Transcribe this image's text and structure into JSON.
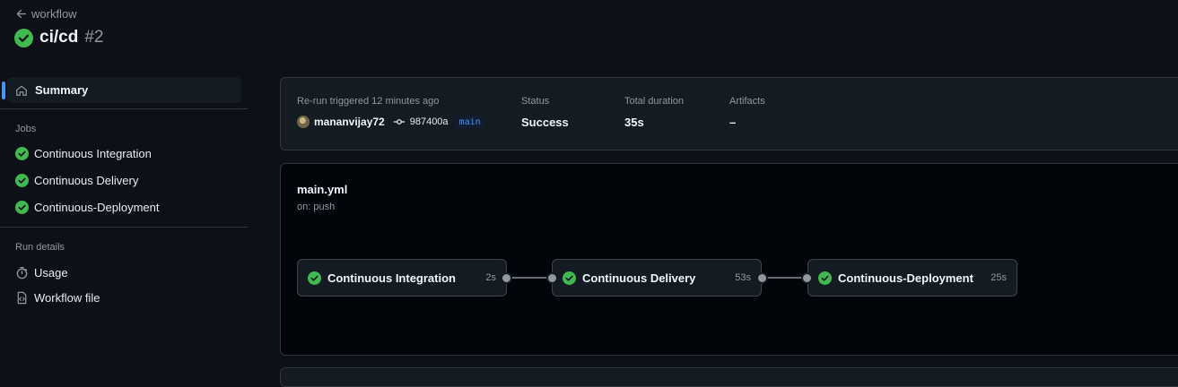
{
  "header": {
    "back_label": "workflow",
    "title": "ci/cd",
    "run_number": "#2"
  },
  "sidebar": {
    "summary_label": "Summary",
    "jobs_heading": "Jobs",
    "jobs": [
      {
        "label": "Continuous Integration"
      },
      {
        "label": "Continuous Delivery"
      },
      {
        "label": "Continuous-Deployment"
      }
    ],
    "run_details_heading": "Run details",
    "run_details": [
      {
        "label": "Usage",
        "icon": "stopwatch-icon"
      },
      {
        "label": "Workflow file",
        "icon": "file-code-icon"
      }
    ]
  },
  "summary": {
    "trigger_text": "Re-run triggered 12 minutes ago",
    "actor": "mananvijay72",
    "commit_sha": "987400a",
    "branch": "main",
    "status_label": "Status",
    "status_value": "Success",
    "duration_label": "Total duration",
    "duration_value": "35s",
    "artifacts_label": "Artifacts",
    "artifacts_value": "–"
  },
  "workflow": {
    "file": "main.yml",
    "trigger": "on: push",
    "jobs": [
      {
        "name": "Continuous Integration",
        "duration": "2s"
      },
      {
        "name": "Continuous Delivery",
        "duration": "53s"
      },
      {
        "name": "Continuous-Deployment",
        "duration": "25s"
      }
    ]
  },
  "colors": {
    "success": "#3fb950",
    "accent": "#4493f8",
    "background": "#0d1117"
  }
}
